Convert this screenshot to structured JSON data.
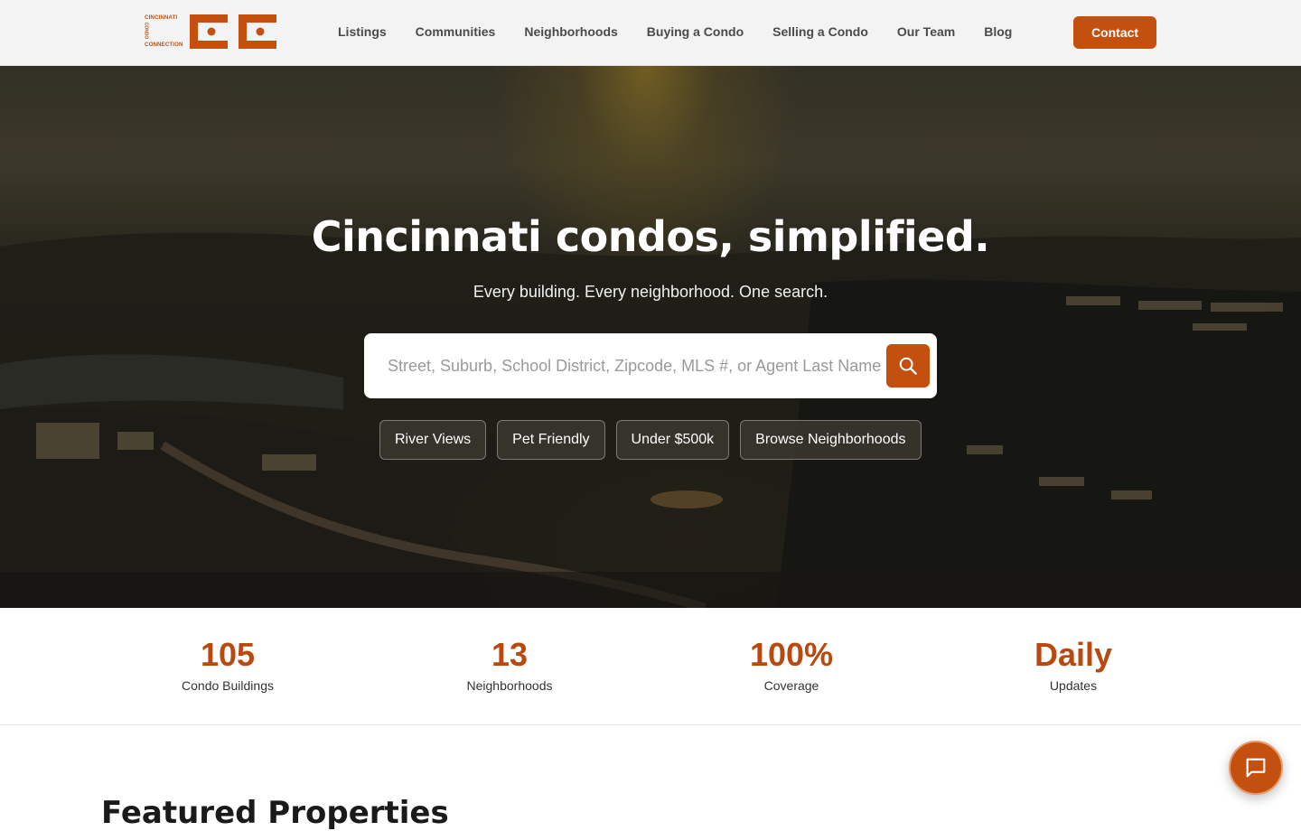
{
  "brand": {
    "logo_line1": "CINCINNATI",
    "logo_line2": "CONDO",
    "logo_line3": "CONNECTION",
    "accent_color": "#c4500f"
  },
  "nav": {
    "links": [
      {
        "label": "Listings"
      },
      {
        "label": "Communities"
      },
      {
        "label": "Neighborhoods"
      },
      {
        "label": "Buying a Condo"
      },
      {
        "label": "Selling a Condo"
      },
      {
        "label": "Our Team"
      },
      {
        "label": "Blog"
      }
    ],
    "contact_label": "Contact"
  },
  "hero": {
    "title": "Cincinnati condos, simplified.",
    "subtitle": "Every building. Every neighborhood. One search.",
    "search": {
      "placeholder": "Street, Suburb, School District, Zipcode, MLS #, or Agent Last Name",
      "value": "",
      "button_icon": "search-icon"
    },
    "chips": [
      {
        "label": "River Views"
      },
      {
        "label": "Pet Friendly"
      },
      {
        "label": "Under $500k"
      },
      {
        "label": "Browse Neighborhoods"
      }
    ]
  },
  "stats": [
    {
      "value": "105",
      "label": "Condo Buildings"
    },
    {
      "value": "13",
      "label": "Neighborhoods"
    },
    {
      "value": "100%",
      "label": "Coverage"
    },
    {
      "value": "Daily",
      "label": "Updates"
    }
  ],
  "featured": {
    "title": "Featured Properties"
  },
  "chat": {
    "icon": "chat-icon"
  }
}
